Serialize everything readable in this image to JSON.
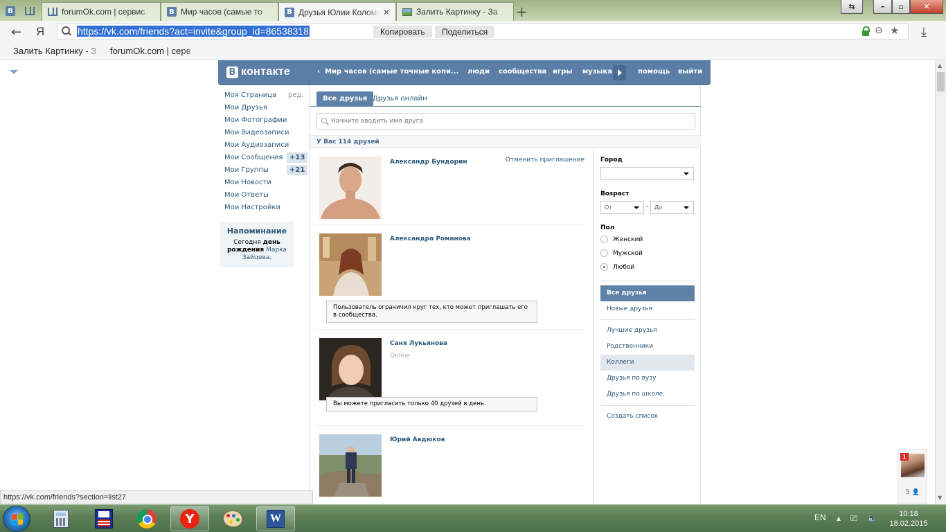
{
  "browser": {
    "tabs": [
      {
        "title": "forumOk.com | сервис"
      },
      {
        "title": "Мир часов (самые то"
      },
      {
        "title": "Друзья Юлии Коломе"
      },
      {
        "title": "Залить Картинку - За"
      }
    ],
    "address": {
      "url": "https://vk.com/friends?act=invite&group_id=86538318",
      "copy_label": "Копировать",
      "share_label": "Поделиться"
    },
    "bookmarks": [
      "Залить Картинку - З",
      "forumOk.com | серв"
    ],
    "yandex_glyph": "Я",
    "status_url": "https://vk.com/friends?section=list27"
  },
  "vk": {
    "logo_letter": "В",
    "logo_text": "контакте",
    "back_group": "Мир часов (самые точные копи...",
    "nav": {
      "people": "люди",
      "groups": "сообщества",
      "games": "игры",
      "music": "музыка",
      "help": "помощь",
      "logout": "выйти"
    },
    "left_menu": {
      "my_page": "Моя Страница",
      "edit": "ред.",
      "friends": "Мои Друзья",
      "photos": "Мои Фотографии",
      "videos": "Мои Видеозаписи",
      "audios": "Мои Аудиозаписи",
      "messages": "Мои Сообщения",
      "messages_count": "+13",
      "groups": "Мои Группы",
      "groups_count": "+21",
      "news": "Мои Новости",
      "answers": "Мои Ответы",
      "settings": "Мои Настройки"
    },
    "reminder": {
      "title": "Напоминание",
      "pre": "Сегодня ",
      "bold": "день рождения",
      "name": "Марка Зайцева",
      "post": "."
    },
    "tabs": {
      "all": "Все друзья",
      "online": "Друзья онлайн"
    },
    "search_placeholder": "Начните вводить имя друга",
    "friend_count": "У Вас 114 друзей",
    "friends": [
      {
        "name": "Александр Бундорин",
        "action": "Отменить приглашение"
      },
      {
        "name": "Александра Романова",
        "notice": "Пользователь ограничил круг тех, кто может приглашать его в сообщества."
      },
      {
        "name": "Саня Лукьянова",
        "status": "Online",
        "notice": "Вы можете пригласить только 40 друзей в день."
      },
      {
        "name": "Юрий Авдюков"
      }
    ],
    "filters": {
      "city_label": "Город",
      "city_value": "",
      "age_label": "Возраст",
      "age_from": "От",
      "age_dash": "-",
      "age_to": "До",
      "gender_label": "Пол",
      "female": "Женский",
      "male": "Мужской",
      "any": "Любой",
      "selected_gender": "any"
    },
    "lists": {
      "all": "Все друзья",
      "new": "Новые друзья",
      "best": "Лучшие друзья",
      "relatives": "Родственники",
      "colleagues": "Коллеги",
      "university": "Друзья по вузу",
      "school": "Друзья по школе",
      "create": "Создать список"
    },
    "chat": {
      "badge": "1",
      "count": "5"
    }
  },
  "taskbar": {
    "lang": "EN",
    "time": "10:18",
    "date": "18.02.2015",
    "word_glyph": "W",
    "yandex_glyph": "Y"
  },
  "colors": {
    "vk_blue": "#5a7ea5",
    "vk_link": "#2b587a",
    "url_highlight": "#3370d4"
  }
}
